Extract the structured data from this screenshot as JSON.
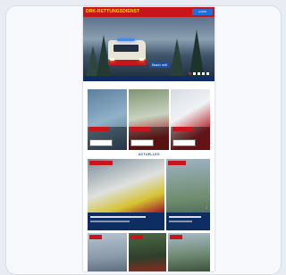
{
  "header": {
    "logo_text": "DRK-RETTUNGSDIENST",
    "login_label": "LOGIN"
  },
  "hero": {
    "caption": "Mach mit!"
  },
  "section": {
    "title": "AKTUELLES"
  },
  "colors": {
    "brand_red": "#c8151b",
    "brand_blue": "#1e6fd6",
    "navy": "#0e2e63",
    "logo_yellow": "#ffd200"
  }
}
